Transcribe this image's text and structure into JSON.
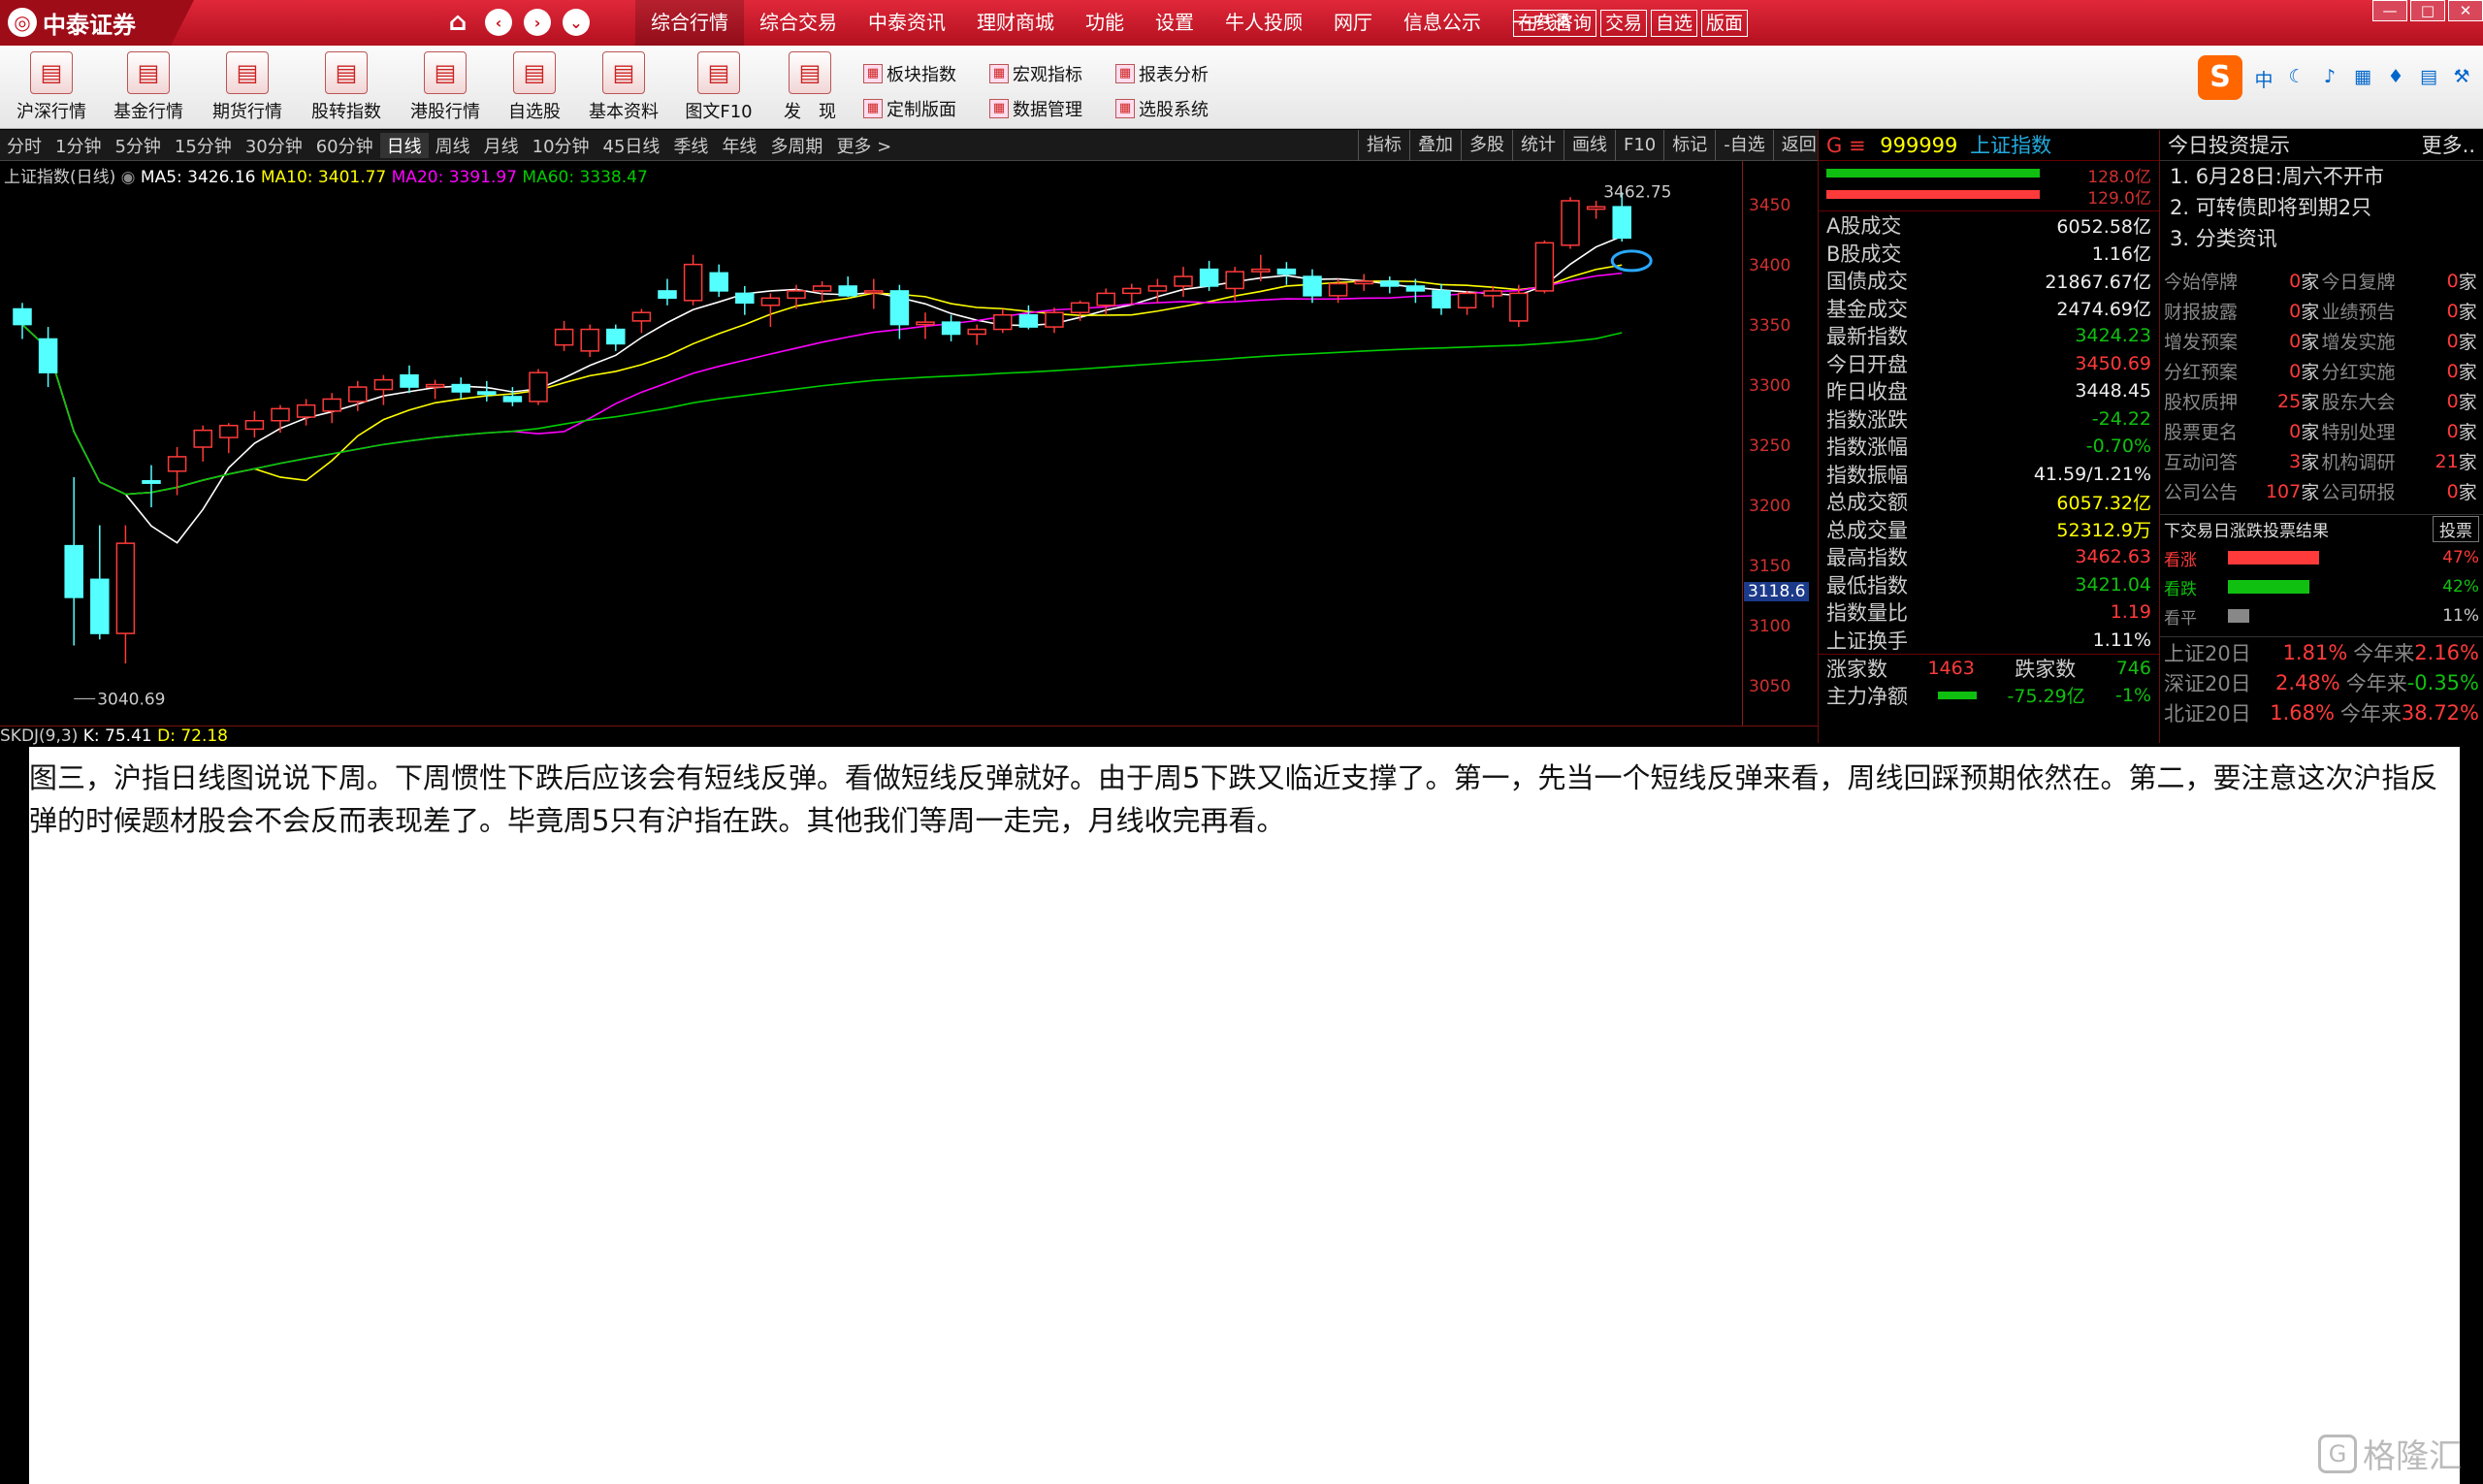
{
  "app": {
    "logo": "中泰证券",
    "menu": [
      "综合行情",
      "综合交易",
      "中泰资讯",
      "理财商城",
      "功能",
      "设置",
      "牛人投顾",
      "网厅",
      "信息公示",
      "一户通"
    ],
    "menu_boxes": [
      "在线咨询",
      "交易",
      "自选",
      "版面"
    ]
  },
  "toolbar": {
    "big": [
      "沪深行情",
      "基金行情",
      "期货行情",
      "股转指数",
      "港股行情",
      "自选股",
      "基本资料",
      "图文F10",
      "发　现"
    ],
    "small": [
      "板块指数",
      "宏观指标",
      "报表分析",
      "定制版面",
      "数据管理",
      "选股系统"
    ]
  },
  "period_bar": [
    "分时",
    "1分钟",
    "5分钟",
    "15分钟",
    "30分钟",
    "60分钟",
    "日线",
    "周线",
    "月线",
    "10分钟",
    "45日线",
    "季线",
    "年线",
    "多周期",
    "更多 >"
  ],
  "period_active": "日线",
  "chart_tools": [
    "指标",
    "叠加",
    "多股",
    "统计",
    "画线",
    "F10",
    "标记",
    "-自选",
    "返回"
  ],
  "chart": {
    "legend_title": "上证指数(日线)",
    "ma5": "MA5: 3426.16",
    "ma10": "MA10: 3401.77",
    "ma20": "MA20: 3391.97",
    "ma60": "MA60: 3338.47",
    "high_label": "3462.75",
    "low_label": "3040.69",
    "current_price": "3118.6",
    "axis_ticks": [
      "3450",
      "3400",
      "3350",
      "3300",
      "3250",
      "3200",
      "3150",
      "3100",
      "3050"
    ],
    "indicator": "SKDJ(9,3)",
    "k": "K: 75.41",
    "d": "D: 72.18",
    "colors": {
      "ma5": "#ffffff",
      "ma10": "#ffff00",
      "ma20": "#ff00ff",
      "ma60": "#00cc00",
      "up": "#ff3a3a",
      "down": "#54ffff"
    }
  },
  "quote": {
    "g": "G ≡",
    "code": "999999",
    "name": "上证指数",
    "vol1": "128.0亿",
    "vol2": "129.0亿",
    "rows": [
      {
        "k": "A股成交",
        "v": "6052.58亿",
        "c": "white"
      },
      {
        "k": "B股成交",
        "v": "1.16亿",
        "c": "white"
      },
      {
        "k": "国债成交",
        "v": "21867.67亿",
        "c": "white"
      },
      {
        "k": "基金成交",
        "v": "2474.69亿",
        "c": "white"
      },
      {
        "k": "最新指数",
        "v": "3424.23",
        "c": "green"
      },
      {
        "k": "今日开盘",
        "v": "3450.69",
        "c": "red"
      },
      {
        "k": "昨日收盘",
        "v": "3448.45",
        "c": "white"
      },
      {
        "k": "指数涨跌",
        "v": "-24.22",
        "c": "green"
      },
      {
        "k": "指数涨幅",
        "v": "-0.70%",
        "c": "green"
      },
      {
        "k": "指数振幅",
        "v": "41.59/1.21%",
        "c": "white"
      },
      {
        "k": "总成交额",
        "v": "6057.32亿",
        "c": "yellow"
      },
      {
        "k": "总成交量",
        "v": "52312.9万",
        "c": "yellow"
      },
      {
        "k": "最高指数",
        "v": "3462.63",
        "c": "red"
      },
      {
        "k": "最低指数",
        "v": "3421.04",
        "c": "green"
      },
      {
        "k": "指数量比",
        "v": "1.19",
        "c": "red"
      },
      {
        "k": "上证换手",
        "v": "1.11%",
        "c": "white"
      }
    ],
    "up_label": "涨家数",
    "up_value": "1463",
    "down_label": "跌家数",
    "down_value": "746",
    "flow_label": "主力净额",
    "flow_value": "-75.29亿",
    "flow_pct": "-1%"
  },
  "tips": {
    "title": "今日投资提示",
    "more": "更多..",
    "items": [
      "1. 6月28日:周六不开市",
      "2. 可转债即将到期2只",
      "3. 分类资讯"
    ],
    "stats": [
      {
        "a": "今始停牌",
        "an": "0",
        "b": "今日复牌",
        "bn": "0"
      },
      {
        "a": "财报披露",
        "an": "0",
        "b": "业绩预告",
        "bn": "0"
      },
      {
        "a": "增发预案",
        "an": "0",
        "b": "增发实施",
        "bn": "0"
      },
      {
        "a": "分红预案",
        "an": "0",
        "b": "分红实施",
        "bn": "0"
      },
      {
        "a": "股权质押",
        "an": "25",
        "b": "股东大会",
        "bn": "0"
      },
      {
        "a": "股票更名",
        "an": "0",
        "b": "特别处理",
        "bn": "0"
      },
      {
        "a": "互动问答",
        "an": "3",
        "b": "机构调研",
        "bn": "21"
      },
      {
        "a": "公司公告",
        "an": "107",
        "b": "公司研报",
        "bn": "0"
      }
    ],
    "unit": "家",
    "vote_title": "下交易日涨跌投票结果",
    "vote_btn": "投票",
    "votes": [
      {
        "label": "看涨",
        "pct": "47%",
        "frac": 0.47,
        "color": "#ff3a3a"
      },
      {
        "label": "看跌",
        "pct": "42%",
        "frac": 0.42,
        "color": "#10c010"
      },
      {
        "label": "看平",
        "pct": "11%",
        "frac": 0.11,
        "color": "#888888"
      }
    ],
    "sums": [
      {
        "a": "上证20日",
        "av": "1.81%",
        "b": "今年来",
        "bv": "2.16%",
        "ac": "red",
        "bc": "red"
      },
      {
        "a": "深证20日",
        "av": "2.48%",
        "b": "今年来",
        "bv": "-0.35%",
        "ac": "red",
        "bc": "green"
      },
      {
        "a": "北证20日",
        "av": "1.68%",
        "b": "今年来",
        "bv": "38.72%",
        "ac": "red",
        "bc": "red"
      }
    ]
  },
  "article": "图三，沪指日线图说说下周。下周惯性下跌后应该会有短线反弹。看做短线反弹就好。由于周5下跌又临近支撑了。第一，先当一个短线反弹来看，周线回踩预期依然在。第二，要注意这次沪指反弹的时候题材股会不会反而表现差了。毕竟周5只有沪指在跌。其他我们等周一走完，月线收完再看。",
  "watermark": "格隆汇",
  "candles": [
    [
      3365,
      3370,
      3340,
      3352
    ],
    [
      3340,
      3350,
      3300,
      3312
    ],
    [
      3168,
      3225,
      3085,
      3125
    ],
    [
      3140,
      3185,
      3090,
      3095
    ],
    [
      3095,
      3185,
      3070,
      3170
    ],
    [
      3222,
      3235,
      3200,
      3220
    ],
    [
      3230,
      3250,
      3210,
      3242
    ],
    [
      3250,
      3268,
      3238,
      3264
    ],
    [
      3258,
      3270,
      3245,
      3268
    ],
    [
      3265,
      3280,
      3258,
      3272
    ],
    [
      3272,
      3285,
      3262,
      3282
    ],
    [
      3275,
      3290,
      3268,
      3285
    ],
    [
      3280,
      3295,
      3270,
      3290
    ],
    [
      3288,
      3305,
      3280,
      3300
    ],
    [
      3298,
      3310,
      3285,
      3306
    ],
    [
      3310,
      3318,
      3295,
      3300
    ],
    [
      3300,
      3306,
      3290,
      3302
    ],
    [
      3302,
      3308,
      3290,
      3296
    ],
    [
      3296,
      3305,
      3288,
      3294
    ],
    [
      3292,
      3300,
      3284,
      3288
    ],
    [
      3288,
      3315,
      3285,
      3312
    ],
    [
      3335,
      3355,
      3330,
      3348
    ],
    [
      3330,
      3352,
      3325,
      3348
    ],
    [
      3348,
      3352,
      3330,
      3336
    ],
    [
      3355,
      3365,
      3345,
      3362
    ],
    [
      3380,
      3390,
      3368,
      3374
    ],
    [
      3372,
      3410,
      3368,
      3402
    ],
    [
      3395,
      3402,
      3375,
      3380
    ],
    [
      3378,
      3384,
      3360,
      3370
    ],
    [
      3368,
      3378,
      3350,
      3374
    ],
    [
      3374,
      3385,
      3365,
      3380
    ],
    [
      3380,
      3388,
      3370,
      3384
    ],
    [
      3384,
      3392,
      3375,
      3376
    ],
    [
      3380,
      3390,
      3365,
      3380
    ],
    [
      3380,
      3385,
      3340,
      3352
    ],
    [
      3352,
      3362,
      3340,
      3354
    ],
    [
      3354,
      3360,
      3338,
      3344
    ],
    [
      3344,
      3352,
      3335,
      3348
    ],
    [
      3348,
      3365,
      3345,
      3360
    ],
    [
      3360,
      3368,
      3348,
      3350
    ],
    [
      3350,
      3366,
      3345,
      3362
    ],
    [
      3362,
      3372,
      3355,
      3370
    ],
    [
      3368,
      3382,
      3360,
      3378
    ],
    [
      3378,
      3386,
      3368,
      3382
    ],
    [
      3380,
      3390,
      3370,
      3384
    ],
    [
      3384,
      3400,
      3375,
      3392
    ],
    [
      3398,
      3405,
      3380,
      3384
    ],
    [
      3382,
      3400,
      3372,
      3396
    ],
    [
      3396,
      3410,
      3388,
      3398
    ],
    [
      3398,
      3404,
      3385,
      3394
    ],
    [
      3392,
      3398,
      3370,
      3376
    ],
    [
      3376,
      3390,
      3370,
      3386
    ],
    [
      3386,
      3394,
      3380,
      3388
    ],
    [
      3388,
      3392,
      3378,
      3384
    ],
    [
      3384,
      3390,
      3370,
      3380
    ],
    [
      3380,
      3386,
      3360,
      3366
    ],
    [
      3366,
      3380,
      3360,
      3378
    ],
    [
      3376,
      3384,
      3366,
      3380
    ],
    [
      3355,
      3385,
      3350,
      3378
    ],
    [
      3380,
      3422,
      3378,
      3420
    ],
    [
      3418,
      3458,
      3415,
      3455
    ],
    [
      3448,
      3455,
      3440,
      3450
    ],
    [
      3450,
      3462,
      3421,
      3424
    ]
  ]
}
